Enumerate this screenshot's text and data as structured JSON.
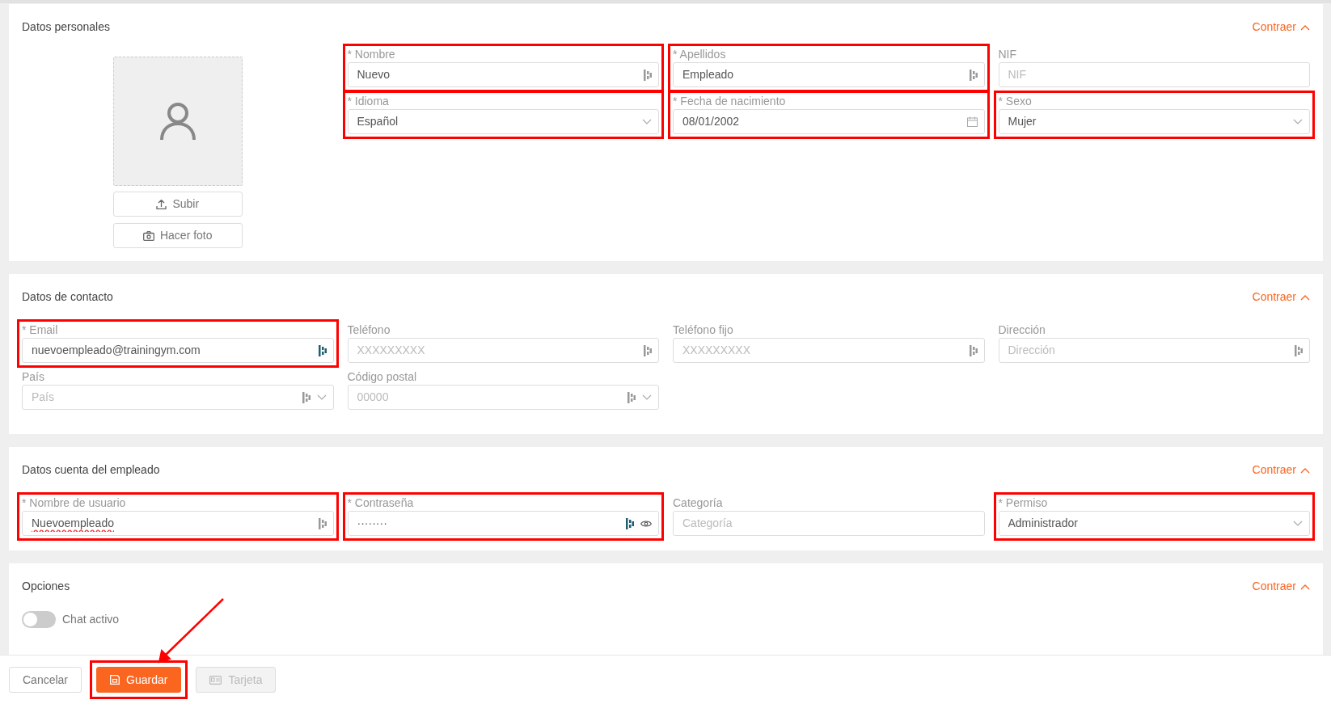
{
  "sections": [
    {
      "title": "Datos personales",
      "collapse_label": "Contraer",
      "photo": {
        "buttons": [
          {
            "label": "Subir",
            "kind": "upload"
          },
          {
            "label": "Hacer foto",
            "kind": "camera"
          }
        ]
      },
      "fields": [
        {
          "label": "* Nombre",
          "kind": "text",
          "value": "Nuevo",
          "autofill_active": false,
          "highlighted": true
        },
        {
          "label": "* Apellidos",
          "kind": "text",
          "value": "Empleado",
          "autofill_active": false,
          "highlighted": true
        },
        {
          "label": "NIF",
          "kind": "text",
          "placeholder": "NIF",
          "highlighted": false
        },
        {
          "label": "* Idioma",
          "kind": "select",
          "value": "Español",
          "highlighted": true
        },
        {
          "label": "* Fecha de nacimiento",
          "kind": "date",
          "value": "08/01/2002",
          "highlighted": true
        },
        {
          "label": "* Sexo",
          "kind": "select",
          "value": "Mujer",
          "highlighted": true
        }
      ]
    },
    {
      "title": "Datos de contacto",
      "collapse_label": "Contraer",
      "fields": [
        {
          "label": "* Email",
          "kind": "text",
          "value": "nuevoempleado@trainingym.com",
          "autofill_active": true,
          "highlighted": true
        },
        {
          "label": "Teléfono",
          "kind": "text",
          "placeholder": "XXXXXXXXX",
          "autofill_active": false,
          "highlighted": false
        },
        {
          "label": "Teléfono fijo",
          "kind": "text",
          "placeholder": "XXXXXXXXX",
          "autofill_active": false,
          "highlighted": false
        },
        {
          "label": "Dirección",
          "kind": "text",
          "placeholder": "Dirección",
          "autofill_active": false,
          "highlighted": false
        },
        {
          "label": "País",
          "kind": "select",
          "placeholder": "País",
          "autofill_active": false,
          "highlighted": false
        },
        {
          "label": "Código postal",
          "kind": "select",
          "placeholder": "00000",
          "autofill_active": false,
          "highlighted": false
        }
      ]
    },
    {
      "title": "Datos cuenta del empleado",
      "collapse_label": "Contraer",
      "fields": [
        {
          "label": "* Nombre de usuario",
          "kind": "text",
          "value": "Nuevoempleado",
          "spellcheck_error": true,
          "autofill_active": false,
          "highlighted": true
        },
        {
          "label": "* Contraseña",
          "kind": "password",
          "value": "········",
          "autofill_active": true,
          "highlighted": true
        },
        {
          "label": "Categoría",
          "kind": "text",
          "placeholder": "Categoría",
          "highlighted": false
        },
        {
          "label": "* Permiso",
          "kind": "select",
          "value": "Administrador",
          "highlighted": true
        }
      ]
    },
    {
      "title": "Opciones",
      "collapse_label": "Contraer",
      "toggles": [
        {
          "label": "Chat activo",
          "on": false
        }
      ]
    }
  ],
  "footer": {
    "buttons": [
      {
        "label": "Cancelar",
        "kind": "cancel",
        "disabled": false,
        "highlighted": false
      },
      {
        "label": "Guardar",
        "kind": "save",
        "disabled": false,
        "highlighted": true
      },
      {
        "label": "Tarjeta",
        "kind": "card",
        "disabled": true,
        "highlighted": false
      }
    ]
  },
  "annotation_arrow": true
}
